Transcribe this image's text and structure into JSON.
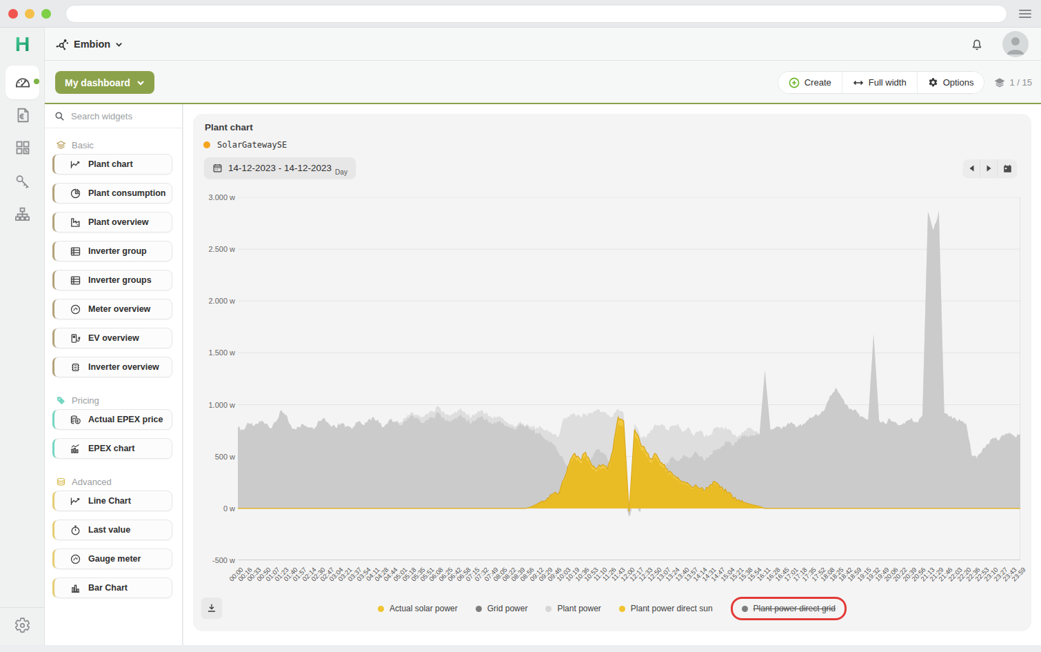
{
  "browser": {
    "url_value": ""
  },
  "app": {
    "logo_letter": "H",
    "org_name": "Embion"
  },
  "toolbar": {
    "dashboard_label": "My dashboard",
    "create_label": "Create",
    "full_width_label": "Full width",
    "options_label": "Options",
    "pages_label": "1 / 15"
  },
  "panel": {
    "search_placeholder": "Search widgets",
    "sections": [
      {
        "label": "Basic",
        "color": "#b3a179",
        "items": [
          {
            "label": "Plant chart"
          },
          {
            "label": "Plant consumption"
          },
          {
            "label": "Plant overview"
          },
          {
            "label": "Inverter group"
          },
          {
            "label": "Inverter groups"
          },
          {
            "label": "Meter overview"
          },
          {
            "label": "EV overview"
          },
          {
            "label": "Inverter overview"
          }
        ]
      },
      {
        "label": "Pricing",
        "color": "#74d6c1",
        "items": [
          {
            "label": "Actual EPEX price"
          },
          {
            "label": "EPEX chart"
          }
        ]
      },
      {
        "label": "Advanced",
        "color": "#e6cd74",
        "items": [
          {
            "label": "Line Chart"
          },
          {
            "label": "Last value"
          },
          {
            "label": "Gauge meter"
          },
          {
            "label": "Bar Chart"
          }
        ]
      }
    ]
  },
  "widget": {
    "title": "Plant chart",
    "source_name": "SolarGatewaySE",
    "source_dot_color": "#f5a51d",
    "date_range": "14-12-2023 - 14-12-2023",
    "date_mode": "Day",
    "annotation_color": "#e23a36"
  },
  "chart_data": {
    "type": "area",
    "title": "Plant chart",
    "ylim": [
      -500,
      3000
    ],
    "grid": true,
    "legend_position": "bottom",
    "y_labels": [
      "3.000 w",
      "2.500 w",
      "2.000 w",
      "1.500 w",
      "1.000 w",
      "500 w",
      "0 w",
      "-500 w"
    ],
    "x_labels": [
      "00:00",
      "00:16",
      "00:33",
      "00:50",
      "01:07",
      "01:23",
      "01:40",
      "01:57",
      "02:14",
      "02:30",
      "02:47",
      "03:04",
      "03:21",
      "03:37",
      "03:54",
      "04:11",
      "04:28",
      "04:44",
      "05:01",
      "05:18",
      "05:35",
      "05:51",
      "06:08",
      "06:25",
      "06:42",
      "06:58",
      "07:15",
      "07:32",
      "07:49",
      "08:05",
      "08:22",
      "08:39",
      "08:56",
      "09:12",
      "09:29",
      "09:46",
      "10:03",
      "10:19",
      "10:36",
      "10:53",
      "11:10",
      "11:26",
      "11:43",
      "12:00",
      "12:17",
      "12:33",
      "12:50",
      "13:07",
      "13:24",
      "13:40",
      "13:57",
      "14:14",
      "14:31",
      "14:47",
      "15:04",
      "15:21",
      "15:38",
      "15:54",
      "16:11",
      "16:28",
      "16:45",
      "17:01",
      "17:18",
      "17:35",
      "17:52",
      "18:08",
      "18:25",
      "18:42",
      "18:59",
      "19:15",
      "19:32",
      "19:49",
      "20:06",
      "20:22",
      "20:39",
      "20:56",
      "21:13",
      "21:29",
      "21:46",
      "22:03",
      "22:20",
      "22:36",
      "22:53",
      "23:10",
      "23:27",
      "23:43",
      "23:59"
    ],
    "noise_amplitude": 22,
    "series": [
      {
        "name": "Plant power",
        "area_color": "#dedede",
        "legend_color": "#d6d6d6",
        "values": [
          780,
          755,
          820,
          795,
          845,
          810,
          770,
          835,
          948,
          900,
          765,
          790,
          810,
          782,
          760,
          842,
          868,
          800,
          778,
          822,
          790,
          762,
          830,
          808,
          852,
          878,
          820,
          792,
          858,
          832,
          832,
          872,
          928,
          898,
          882,
          910,
          938,
          978,
          920,
          892,
          930,
          968,
          910,
          882,
          918,
          948,
          902,
          872,
          880,
          850,
          812,
          792,
          840,
          800,
          790,
          780,
          775,
          760,
          710,
          690,
          870,
          880,
          910,
          890,
          905,
          920,
          950,
          930,
          900,
          880,
          960,
          920,
          -60,
          820,
          700,
          680,
          760,
          800,
          820,
          760,
          800,
          820,
          740,
          780,
          700,
          750,
          690,
          710,
          780,
          790,
          760,
          720,
          690,
          730,
          770,
          745,
          716,
          1330,
          762,
          782,
          762,
          800,
          822,
          792,
          812,
          852,
          882,
          902,
          952,
          1090,
          1160,
          1080,
          1002,
          952,
          922,
          882,
          852,
          1680,
          852,
          822,
          862,
          832,
          802,
          842,
          872,
          822,
          900,
          2860,
          2680,
          2870,
          920,
          880,
          870,
          842,
          822,
          522,
          482,
          562,
          622,
          682,
          652,
          702,
          732,
          692,
          722
        ]
      },
      {
        "name": "Grid power",
        "area_color": "#cbcbcb",
        "legend_color": "#7d7d7d",
        "values": [
          780,
          755,
          820,
          795,
          845,
          810,
          770,
          835,
          948,
          900,
          765,
          790,
          810,
          782,
          760,
          842,
          868,
          800,
          778,
          822,
          790,
          762,
          830,
          808,
          852,
          878,
          820,
          792,
          858,
          832,
          802,
          842,
          898,
          868,
          822,
          850,
          878,
          918,
          860,
          832,
          870,
          908,
          850,
          822,
          858,
          888,
          842,
          812,
          832,
          802,
          782,
          762,
          820,
          790,
          760,
          730,
          700,
          660,
          620,
          540,
          460,
          380,
          330,
          380,
          300,
          480,
          570,
          540,
          480,
          300,
          100,
          80,
          -80,
          60,
          -40,
          200,
          320,
          420,
          380,
          440,
          500,
          460,
          520,
          480,
          540,
          500,
          460,
          520,
          560,
          600,
          640,
          600,
          660,
          700,
          680,
          700,
          712,
          1330,
          762,
          782,
          762,
          800,
          822,
          792,
          812,
          852,
          882,
          902,
          952,
          1090,
          1160,
          1080,
          1002,
          952,
          922,
          882,
          852,
          1680,
          852,
          822,
          862,
          832,
          802,
          842,
          872,
          822,
          900,
          2860,
          2680,
          2870,
          920,
          880,
          870,
          842,
          822,
          522,
          482,
          562,
          622,
          682,
          652,
          702,
          732,
          692,
          722
        ]
      },
      {
        "name": "Actual solar power",
        "area_color": "#f2ca41",
        "legend_color": "#f0c430",
        "values": [
          0,
          0,
          0,
          0,
          0,
          0,
          0,
          0,
          0,
          0,
          0,
          0,
          0,
          0,
          0,
          0,
          0,
          0,
          0,
          0,
          0,
          0,
          0,
          0,
          0,
          0,
          0,
          0,
          0,
          0,
          0,
          0,
          0,
          0,
          0,
          0,
          0,
          0,
          0,
          0,
          0,
          0,
          0,
          0,
          0,
          0,
          0,
          0,
          0,
          0,
          0,
          0,
          0,
          0,
          15,
          40,
          70,
          100,
          140,
          140,
          280,
          430,
          530,
          470,
          540,
          430,
          380,
          420,
          380,
          560,
          880,
          840,
          -30,
          760,
          640,
          560,
          480,
          520,
          440,
          380,
          330,
          300,
          260,
          230,
          210,
          190,
          170,
          230,
          250,
          210,
          150,
          110,
          80,
          60,
          45,
          30,
          18,
          0,
          0,
          0,
          0,
          0,
          0,
          0,
          0,
          0,
          0,
          0,
          0,
          0,
          0,
          0,
          0,
          0,
          0,
          0,
          0,
          0,
          0,
          0,
          0,
          0,
          0,
          0,
          0,
          0,
          0,
          0,
          0,
          0,
          0,
          0,
          0,
          0,
          0,
          0,
          0,
          0,
          0,
          0,
          0,
          0,
          0,
          0,
          0
        ]
      },
      {
        "name": "Plant power direct sun",
        "area_color": "#e9bb24",
        "legend_color": "#f0c430",
        "values": [
          0,
          0,
          0,
          0,
          0,
          0,
          0,
          0,
          0,
          0,
          0,
          0,
          0,
          0,
          0,
          0,
          0,
          0,
          0,
          0,
          0,
          0,
          0,
          0,
          0,
          0,
          0,
          0,
          0,
          0,
          0,
          0,
          0,
          0,
          0,
          0,
          0,
          0,
          0,
          0,
          0,
          0,
          0,
          0,
          0,
          0,
          0,
          0,
          0,
          0,
          0,
          0,
          0,
          0,
          14,
          37,
          65,
          93,
          130,
          130,
          260,
          400,
          493,
          437,
          502,
          400,
          353,
          390,
          353,
          521,
          818,
          781,
          -28,
          707,
          595,
          521,
          446,
          484,
          409,
          353,
          307,
          279,
          242,
          214,
          195,
          177,
          158,
          214,
          233,
          195,
          140,
          102,
          74,
          56,
          42,
          28,
          17,
          0,
          0,
          0,
          0,
          0,
          0,
          0,
          0,
          0,
          0,
          0,
          0,
          0,
          0,
          0,
          0,
          0,
          0,
          0,
          0,
          0,
          0,
          0,
          0,
          0,
          0,
          0,
          0,
          0,
          0,
          0,
          0,
          0,
          0,
          0,
          0,
          0,
          0,
          0,
          0,
          0,
          0,
          0,
          0,
          0,
          0,
          0,
          0
        ]
      },
      {
        "name": "Plant power direct grid",
        "area_color": "#7d7d7d",
        "legend_color": "#7d7d7d",
        "hidden": true,
        "strikethrough": true,
        "highlighted": true,
        "values": []
      }
    ]
  }
}
